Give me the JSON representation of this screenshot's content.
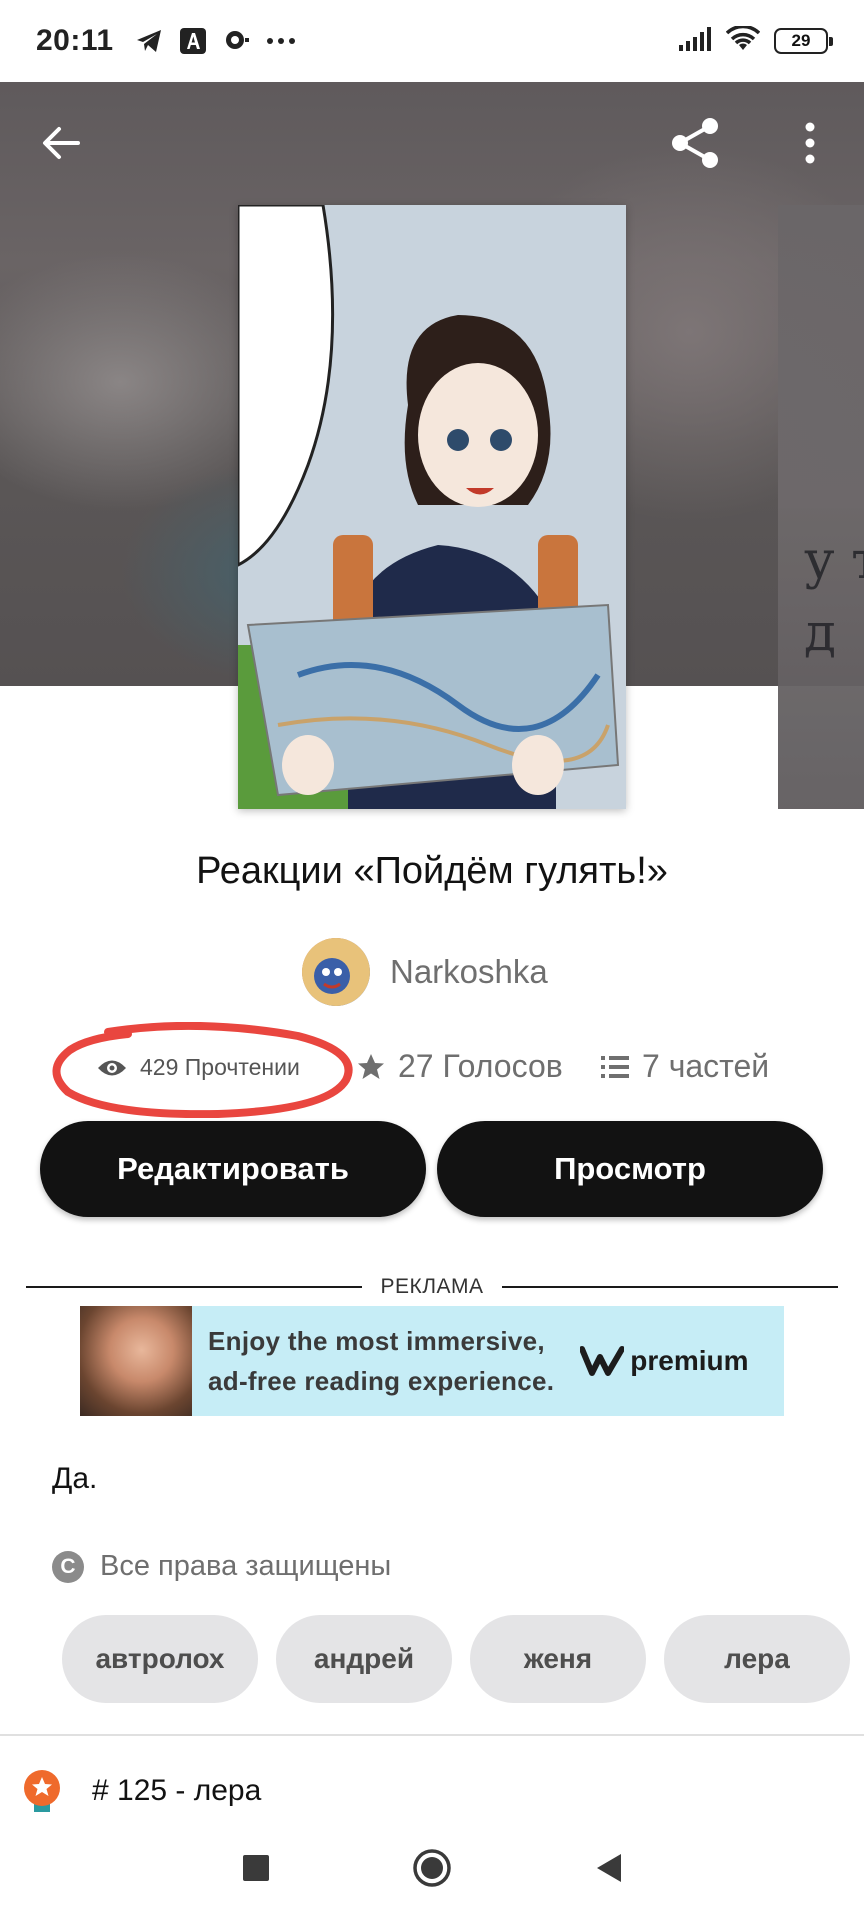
{
  "status_bar": {
    "time": "20:11",
    "battery": "29",
    "left_icons": [
      "telegram-icon",
      "font-app-icon",
      "chat-icon",
      "more-dots-icon"
    ],
    "right_icons": [
      "signal-icon",
      "wifi-icon",
      "battery-icon"
    ]
  },
  "top_bar": {
    "back_icon": "arrow-left-icon",
    "share_icon": "share-icon",
    "menu_icon": "more-vertical-icon"
  },
  "next_cover_text": "у т\nд",
  "story": {
    "title": "Реакции «Пойдём гулять!»",
    "author": "Narkoshka",
    "reads": "429 Прочтении",
    "votes": "27 Голосов",
    "parts": "7 частей"
  },
  "actions": {
    "edit_label": "Редактировать",
    "view_label": "Просмотр"
  },
  "ad": {
    "label": "РЕКЛАМА",
    "line1": "Enjoy the most immersive,",
    "line2": "ad-free reading experience.",
    "brand": "premium"
  },
  "description": "Да.",
  "copyright": "Все права защищены",
  "tags": [
    "автролох",
    "андрей",
    "женя",
    "лера"
  ],
  "ranking": "# 125 - лера",
  "colors": {
    "button_bg": "#121212",
    "highlight_circle": "#e9463f",
    "ad_bg": "#c6edf6",
    "tag_bg": "#e4e4e6",
    "muted_text": "#6f6f6f"
  },
  "nav": [
    "recents-square-icon",
    "home-circle-icon",
    "back-triangle-icon"
  ]
}
